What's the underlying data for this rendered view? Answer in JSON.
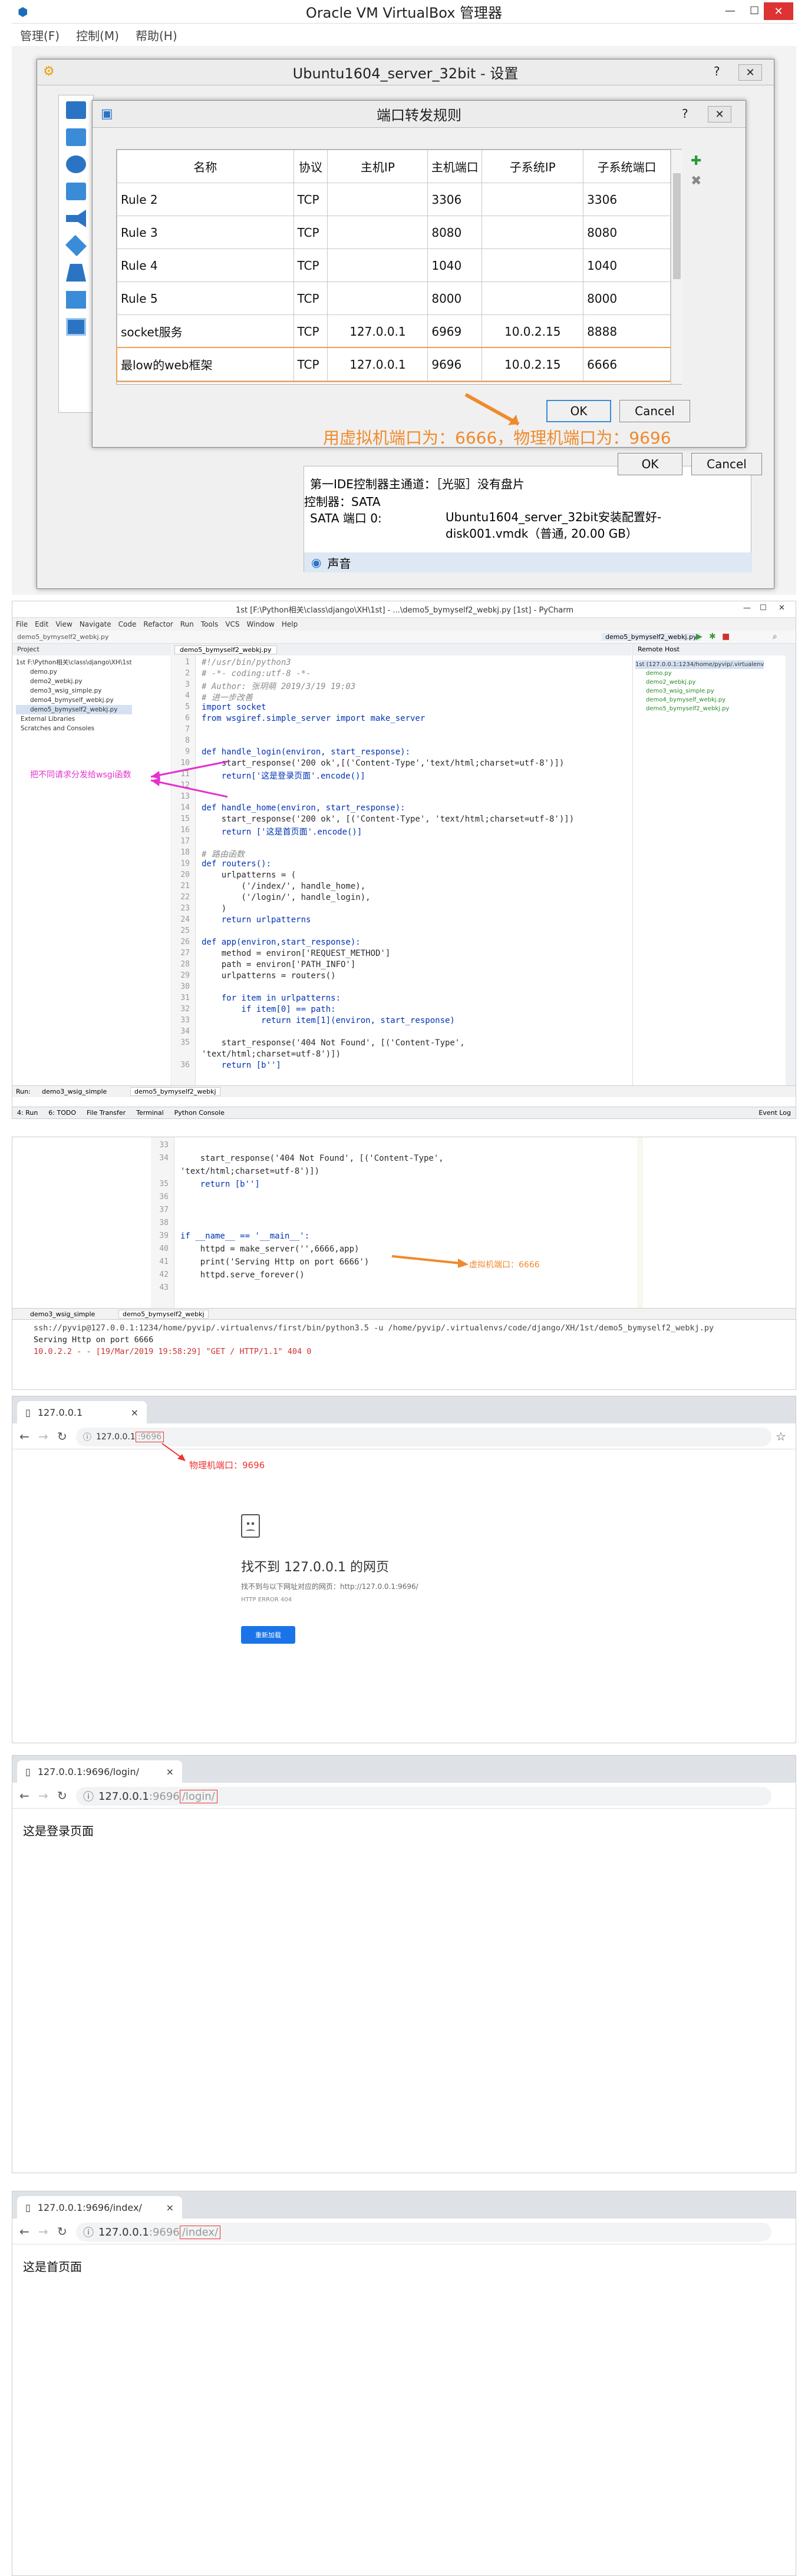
{
  "vbox": {
    "title": "Oracle VM VirtualBox 管理器",
    "menu": [
      "管理(F)",
      "控制(M)",
      "帮助(H)"
    ],
    "settings_title": "Ubuntu1604_server_32bit - 设置",
    "pf_title": "端口转发规则",
    "columns": [
      "名称",
      "协议",
      "主机IP",
      "主机端口",
      "子系统IP",
      "子系统端口"
    ],
    "rows": [
      {
        "name": "Rule 2",
        "proto": "TCP",
        "hip": "",
        "hport": "3306",
        "gip": "",
        "gport": "3306"
      },
      {
        "name": "Rule 3",
        "proto": "TCP",
        "hip": "",
        "hport": "8080",
        "gip": "",
        "gport": "8080"
      },
      {
        "name": "Rule 4",
        "proto": "TCP",
        "hip": "",
        "hport": "1040",
        "gip": "",
        "gport": "1040"
      },
      {
        "name": "Rule 5",
        "proto": "TCP",
        "hip": "",
        "hport": "8000",
        "gip": "",
        "gport": "8000"
      },
      {
        "name": "socket服务",
        "proto": "TCP",
        "hip": "127.0.0.1",
        "hport": "6969",
        "gip": "10.0.2.15",
        "gport": "8888"
      },
      {
        "name": "最low的web框架",
        "proto": "TCP",
        "hip": "127.0.0.1",
        "hport": "9696",
        "gip": "10.0.2.15",
        "gport": "6666"
      }
    ],
    "ok": "OK",
    "cancel": "Cancel",
    "ok2": "OK",
    "cancel2": "Cancel",
    "annotation": "用虚拟机端口为：6666，物理机端口为：9696",
    "storage_line1": "第一IDE控制器主通道：［光驱］没有盘片",
    "storage_line2": "控制器：SATA",
    "storage_line3_label": "SATA 端口 0:",
    "storage_line3_value": "Ubuntu1604_server_32bit安装配置好-disk001.vmdk（普通, 20.00 GB）",
    "storage_audio": "声音"
  },
  "pycharm": {
    "title": "1st [F:\\Python相关\\class\\django\\XH\\1st] - ...\\demo5_bymyself2_webkj.py [1st] - PyCharm",
    "menu": [
      "File",
      "Edit",
      "View",
      "Navigate",
      "Code",
      "Refactor",
      "Run",
      "Tools",
      "VCS",
      "Window",
      "Help"
    ],
    "project_label": "Project",
    "editor_tab": "demo5_bymyself2_webkj.py",
    "remote_host": "Remote Host",
    "tree": [
      "1st F:\\Python相关\\class\\django\\XH\\1st",
      "demo.py",
      "demo2_webkj.py",
      "demo3_wsig_simple.py",
      "demo4_bymyself_webkj.py",
      "demo5_bymyself2_webkj.py",
      "External Libraries",
      "Scratches and Consoles"
    ],
    "remote_tree": [
      "1st (127.0.0.1:1234/home/pyvip/.virtualenv",
      "demo.py",
      "demo2_webkj.py",
      "demo3_wsig_simple.py",
      "demo4_bymyself_webkj.py",
      "demo5_bymyself2_webkj.py"
    ],
    "annotation": "把不同请求分发给wsgi函数",
    "bottom_tabs": [
      "4: Run",
      "6: TODO",
      "File Transfer",
      "Terminal",
      "Python Console"
    ],
    "event_log": "Event Log",
    "run_label": "Run:",
    "run_tabs": [
      "demo3_wsig_simple",
      "demo5_bymyself2_webkj"
    ]
  },
  "code": [
    {
      "n": "1",
      "t": "#!/usr/bin/python3"
    },
    {
      "n": "2",
      "t": "# -*- coding:utf-8 -*-"
    },
    {
      "n": "3",
      "t": "# Author: 张玥萌 2019/3/19 19:03"
    },
    {
      "n": "4",
      "t": "# 进一步改善"
    },
    {
      "n": "5",
      "t": "import socket"
    },
    {
      "n": "6",
      "t": "from wsgiref.simple_server import make_server"
    },
    {
      "n": "7",
      "t": ""
    },
    {
      "n": "8",
      "t": ""
    },
    {
      "n": "9",
      "t": "def handle_login(environ, start_response):"
    },
    {
      "n": "10",
      "t": "    start_response('200 ok',[('Content-Type','text/html;charset=utf-8')])"
    },
    {
      "n": "11",
      "t": "    return['这是登录页面'.encode()]"
    },
    {
      "n": "12",
      "t": ""
    },
    {
      "n": "13",
      "t": ""
    },
    {
      "n": "14",
      "t": "def handle_home(environ, start_response):"
    },
    {
      "n": "15",
      "t": "    start_response('200 ok', [('Content-Type', 'text/html;charset=utf-8')])"
    },
    {
      "n": "16",
      "t": "    return ['这是首页面'.encode()]"
    },
    {
      "n": "17",
      "t": ""
    },
    {
      "n": "18",
      "t": "# 路由函数"
    },
    {
      "n": "19",
      "t": "def routers():"
    },
    {
      "n": "20",
      "t": "    urlpatterns = ("
    },
    {
      "n": "21",
      "t": "        ('/index/', handle_home),"
    },
    {
      "n": "22",
      "t": "        ('/login/', handle_login),"
    },
    {
      "n": "23",
      "t": "    )"
    },
    {
      "n": "24",
      "t": "    return urlpatterns"
    },
    {
      "n": "25",
      "t": ""
    },
    {
      "n": "26",
      "t": "def app(environ,start_response):"
    },
    {
      "n": "27",
      "t": "    method = environ['REQUEST_METHOD']"
    },
    {
      "n": "28",
      "t": "    path = environ['PATH_INFO']"
    },
    {
      "n": "29",
      "t": "    urlpatterns = routers()"
    },
    {
      "n": "30",
      "t": ""
    },
    {
      "n": "31",
      "t": "    for item in urlpatterns:"
    },
    {
      "n": "32",
      "t": "        if item[0] == path:"
    },
    {
      "n": "33",
      "t": "            return item[1](environ, start_response)"
    },
    {
      "n": "34",
      "t": ""
    },
    {
      "n": "35",
      "t": "    start_response('404 Not Found', [('Content-Type',"
    },
    {
      "n": "",
      "t": "'text/html;charset=utf-8')])"
    },
    {
      "n": "36",
      "t": "    return [b'']"
    }
  ],
  "code2": [
    {
      "n": "33",
      "t": ""
    },
    {
      "n": "34",
      "t": "    start_response('404 Not Found', [('Content-Type',"
    },
    {
      "n": "",
      "t": "'text/html;charset=utf-8')])"
    },
    {
      "n": "35",
      "t": "    return [b'']"
    },
    {
      "n": "36",
      "t": ""
    },
    {
      "n": "37",
      "t": ""
    },
    {
      "n": "38",
      "t": ""
    },
    {
      "n": "39",
      "t": "if __name__ == '__main__':"
    },
    {
      "n": "40",
      "t": "    httpd = make_server('',6666,app)"
    },
    {
      "n": "41",
      "t": "    print('Serving Http on port 6666')"
    },
    {
      "n": "42",
      "t": "    httpd.serve_forever()"
    },
    {
      "n": "43",
      "t": ""
    }
  ],
  "code2_annotation": "虚拟机端口：6666",
  "console": {
    "tabs": [
      "demo3_wsig_simple",
      "demo5_bymyself2_webkj"
    ],
    "lines": [
      "ssh://pyvip@127.0.0.1:1234/home/pyvip/.virtualenvs/first/bin/python3.5 -u /home/pyvip/.virtualenvs/code/django/XH/1st/demo5_bymyself2_webkj.py",
      "Serving Http on port 6666",
      "10.0.2.2 - - [19/Mar/2019 19:58:29] \"GET / HTTP/1.1\" 404 0"
    ]
  },
  "browser1": {
    "tab": "127.0.0.1",
    "url_host": "127.0.0.1",
    "url_port": ":9696",
    "annotation": "物理机端口：9696",
    "error_title": "找不到 127.0.0.1 的网页",
    "error_desc": "找不到与以下网址对应的网页：http://127.0.0.1:9696/",
    "error_code": "HTTP ERROR 404",
    "reload": "重新加载"
  },
  "browser2": {
    "tab": "127.0.0.1:9696/login/",
    "url_host": "127.0.0.1",
    "url_port": ":9696",
    "url_path": "/login/",
    "content": "这是登录页面"
  },
  "browser3": {
    "tab": "127.0.0.1:9696/index/",
    "url_host": "127.0.0.1",
    "url_port": ":9696",
    "url_path": "/index/",
    "content": "这是首页面"
  }
}
